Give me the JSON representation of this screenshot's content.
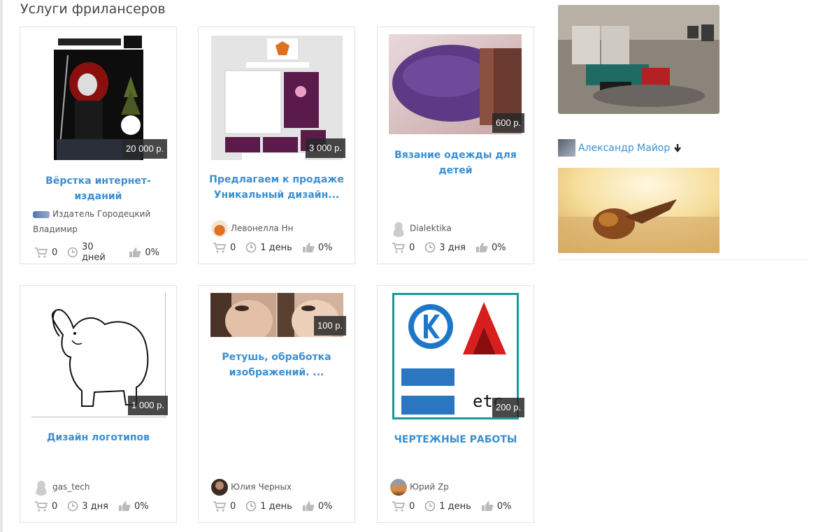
{
  "section": {
    "title": "Услуги фрилансеров"
  },
  "cards": [
    {
      "title": "Вёрстка интернет-изданий",
      "price": "20 000 р.",
      "author": "Издатель Городецкий Владимир",
      "orders": "0",
      "term": "30 дней",
      "rating": "0%",
      "thumb_icon": "magazine-cover-image"
    },
    {
      "title": "Предлагаем к продаже Уникальный дизайн...",
      "price": "3 000 р.",
      "author": "Левонелла Нн",
      "orders": "0",
      "term": "1 день",
      "rating": "0%",
      "thumb_icon": "brand-identity-image"
    },
    {
      "title": "Вязание одежды для детей",
      "price": "600 р.",
      "author": "Dialektika",
      "orders": "0",
      "term": "3 дня",
      "rating": "0%",
      "thumb_icon": "knitted-hat-image"
    },
    {
      "title": "Дизайн логотипов",
      "price": "1 000 р.",
      "author": "gas_tech",
      "orders": "0",
      "term": "3 дня",
      "rating": "0%",
      "thumb_icon": "elephant-drawing-image"
    },
    {
      "title": "Ретушь, обработка изображений. ...",
      "price": "100 р.",
      "author": "Юлия Черных",
      "orders": "0",
      "term": "1 день",
      "rating": "0%",
      "thumb_icon": "face-retouch-image"
    },
    {
      "title": "ЧЕРТЕЖНЫЕ РАБОТЫ",
      "price": "200 р.",
      "author": "Юрий Zp",
      "orders": "0",
      "term": "1 день",
      "rating": "0%",
      "thumb_icon": "cad-logos-image",
      "thumb_text": "etc"
    }
  ],
  "sidebar": {
    "author": "Александр Майор",
    "author_icon": "arrow-down-icon"
  },
  "colors": {
    "link": "#3b8fd0",
    "price_bg": "#333333",
    "border": "#e3e3e3"
  }
}
